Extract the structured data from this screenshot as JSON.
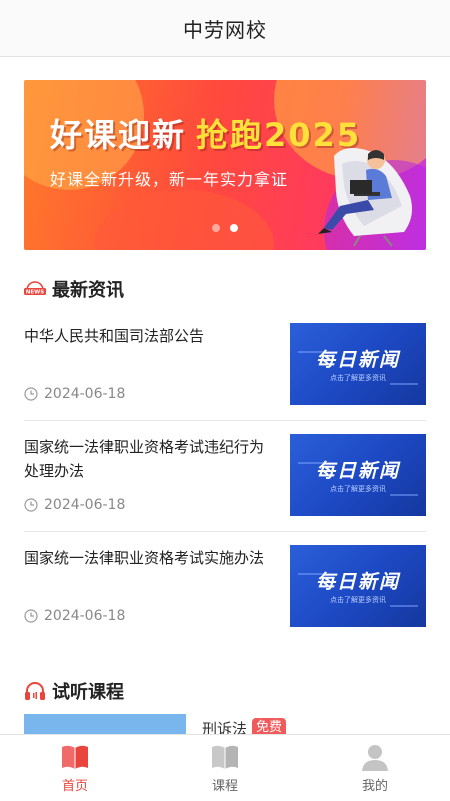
{
  "header": {
    "title": "中劳网校"
  },
  "banner": {
    "headline": "好课迎新",
    "headline_accent": "抢跑2025",
    "subtitle": "好课全新升级，新一年实力拿证",
    "slide_count": 2,
    "active_slide": 2
  },
  "news": {
    "section_title": "最新资讯",
    "icon_text": "NEWS",
    "items": [
      {
        "title": "中华人民共和国司法部公告",
        "date": "2024-06-18",
        "thumb_title": "每日新闻",
        "thumb_sub": "点击了解更多资讯"
      },
      {
        "title": "国家统一法律职业资格考试违纪行为处理办法",
        "date": "2024-06-18",
        "thumb_title": "每日新闻",
        "thumb_sub": "点击了解更多资讯"
      },
      {
        "title": "国家统一法律职业资格考试实施办法",
        "date": "2024-06-18",
        "thumb_title": "每日新闻",
        "thumb_sub": "点击了解更多资讯"
      }
    ]
  },
  "courses": {
    "section_title": "试听课程",
    "items": [
      {
        "name": "刑诉法",
        "badge": "免费"
      }
    ]
  },
  "tabbar": {
    "tabs": [
      {
        "label": "首页",
        "icon": "book-icon",
        "active": true
      },
      {
        "label": "课程",
        "icon": "open-book-icon",
        "active": false
      },
      {
        "label": "我的",
        "icon": "user-icon",
        "active": false
      }
    ]
  },
  "colors": {
    "accent": "#e9453c",
    "thumb_blue": "#1d49c4"
  }
}
